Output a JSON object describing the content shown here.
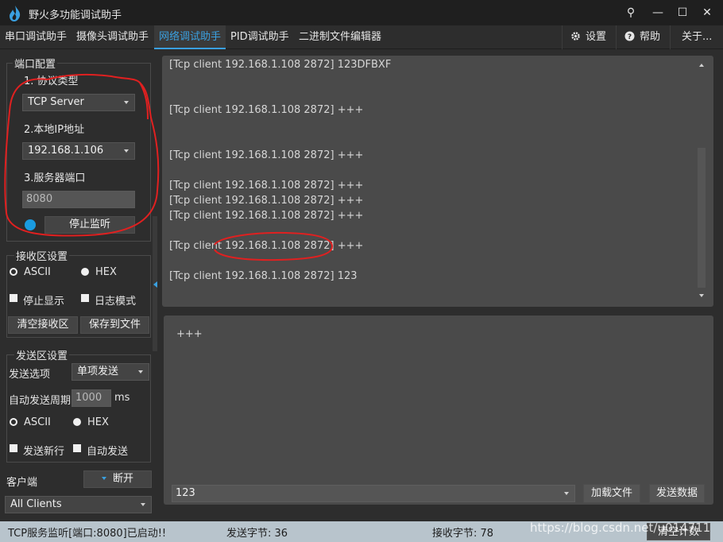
{
  "app": {
    "title": "野火多功能调试助手",
    "colors": {
      "accent": "#3aa0e0",
      "led": "#1a9be0",
      "annotation": "#e02020"
    }
  },
  "window": {
    "pin_glyph": "⚲",
    "minimize_glyph": "—",
    "maximize_glyph": "☐",
    "close_glyph": "✕"
  },
  "tabs": [
    {
      "label": "串口调试助手"
    },
    {
      "label": "摄像头调试助手"
    },
    {
      "label": "网络调试助手",
      "active": true
    },
    {
      "label": "PID调试助手"
    },
    {
      "label": "二进制文件编辑器"
    }
  ],
  "menu": {
    "settings": "设置",
    "help": "帮助",
    "about": "关于..."
  },
  "port_config": {
    "title": "端口配置",
    "protocol_label": "1. 协议类型",
    "protocol_value": "TCP Server",
    "ip_label": "2.本地IP地址",
    "ip_value": "192.168.1.106",
    "port_label": "3.服务器端口",
    "port_value": "8080",
    "listen_button": "停止监听"
  },
  "receive_settings": {
    "title": "接收区设置",
    "ascii": "ASCII",
    "hex": "HEX",
    "stop_display": "停止显示",
    "log_mode": "日志模式",
    "clear_button": "清空接收区",
    "save_button": "保存到文件"
  },
  "send_settings": {
    "title": "发送区设置",
    "option_label": "发送选项",
    "option_value": "单项发送",
    "period_label": "自动发送周期",
    "period_value": "1000",
    "period_unit": "ms",
    "ascii": "ASCII",
    "hex": "HEX",
    "newline": "发送新行",
    "auto_send": "自动发送"
  },
  "client": {
    "label": "客户端",
    "disconnect_button": "断开",
    "clients_value": "All Clients"
  },
  "receive_lines": [
    "[Tcp client 192.168.1.108 2872] 123DFBXF",
    "[Tcp client 192.168.1.108 2872] +++",
    "[Tcp client 192.168.1.108 2872] +++",
    "[Tcp client 192.168.1.108 2872] +++",
    "[Tcp client 192.168.1.108 2872] +++",
    "[Tcp client 192.168.1.108 2872] +++",
    "[Tcp client 192.168.1.108 2872] +++",
    "[Tcp client 192.168.1.108 2872] 123"
  ],
  "send_area": {
    "text": "+++",
    "combo_value": "123",
    "load_file_button": "加载文件",
    "send_button": "发送数据"
  },
  "status": {
    "message": "TCP服务监听[端口:8080]已启动!!",
    "sent": "发送字节: 36",
    "received": "接收字节: 78",
    "clear_count_button": "清空计数"
  },
  "watermark": "https://blog.csdn.net/u014711"
}
